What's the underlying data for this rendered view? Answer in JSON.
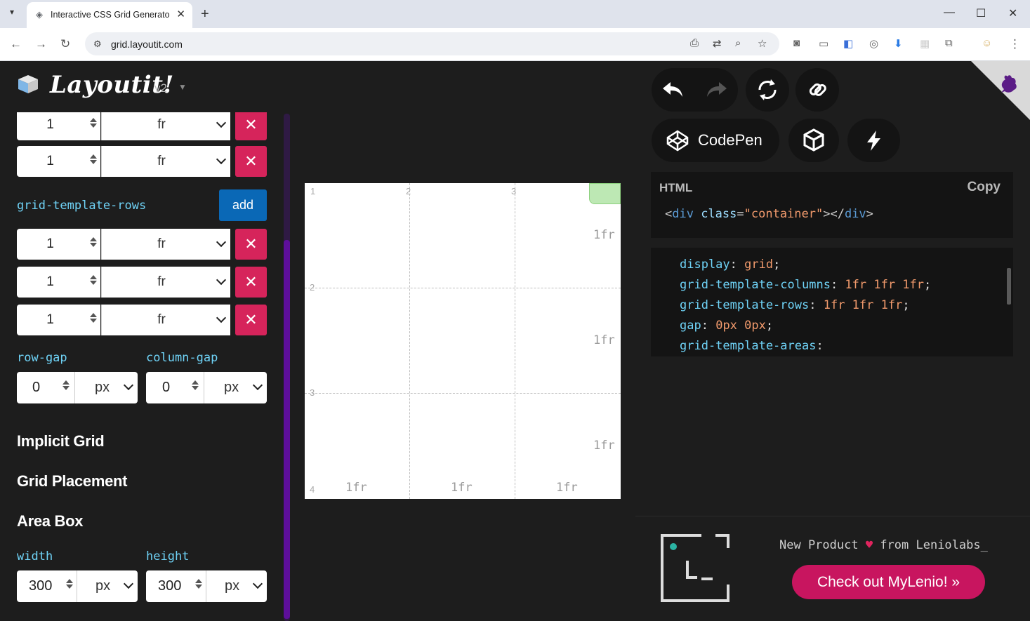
{
  "browser": {
    "tab_title": "Interactive CSS Grid Generator",
    "url": "grid.layoutit.com",
    "new_tab": "+",
    "window_min": "—",
    "window_max": "☐",
    "window_close": "✕"
  },
  "header": {
    "logo_text": "Layoutit!",
    "version": "v2"
  },
  "left": {
    "column_rows": [
      {
        "value": "1",
        "unit": "fr"
      },
      {
        "value": "1",
        "unit": "fr"
      }
    ],
    "rows_label": "grid-template-rows",
    "add_label": "add",
    "row_rows": [
      {
        "value": "1",
        "unit": "fr"
      },
      {
        "value": "1",
        "unit": "fr"
      },
      {
        "value": "1",
        "unit": "fr"
      }
    ],
    "remove_glyph": "✕",
    "row_gap_label": "row-gap",
    "column_gap_label": "column-gap",
    "row_gap": {
      "value": "0",
      "unit": "px"
    },
    "column_gap": {
      "value": "0",
      "unit": "px"
    },
    "implicit_grid": "Implicit Grid",
    "grid_placement": "Grid Placement",
    "area_box": "Area Box",
    "width_label": "width",
    "height_label": "height",
    "width": {
      "value": "300",
      "unit": "px"
    },
    "height": {
      "value": "300",
      "unit": "px"
    }
  },
  "preview": {
    "column_lines": [
      "1",
      "2",
      "3"
    ],
    "row_lines": [
      "2",
      "3",
      "4"
    ],
    "row_sizes": [
      "1fr",
      "1fr",
      "1fr"
    ],
    "column_sizes": [
      "1fr",
      "1fr",
      "1fr"
    ]
  },
  "toolbar": {
    "codepen_label": "CodePen"
  },
  "html_panel": {
    "title": "HTML",
    "copy": "Copy",
    "code_open": "<",
    "code_tag": "div",
    "code_attr": " class",
    "code_eq": "=",
    "code_str": "\"container\"",
    "code_close": "></",
    "code_tag2": "div",
    "code_end": ">"
  },
  "css_panel": {
    "lines": [
      {
        "prop": "display",
        "val": "grid"
      },
      {
        "prop": "grid-template-columns",
        "val": "1fr 1fr 1fr"
      },
      {
        "prop": "grid-template-rows",
        "val": "1fr 1fr 1fr"
      },
      {
        "prop": "gap",
        "val": "0px 0px"
      },
      {
        "prop": "grid-template-areas",
        "val": ""
      }
    ]
  },
  "promo": {
    "text_a": "New Product ",
    "heart": "♥",
    "text_b": " from Leniolabs_",
    "button": "Check out MyLenio! »"
  },
  "colors": {
    "accent_pink": "#d6245b",
    "add_blue": "#0a68b6",
    "label_cyan": "#6fd3f7",
    "value_orange": "#f19a6c",
    "cta": "#c8155f"
  }
}
